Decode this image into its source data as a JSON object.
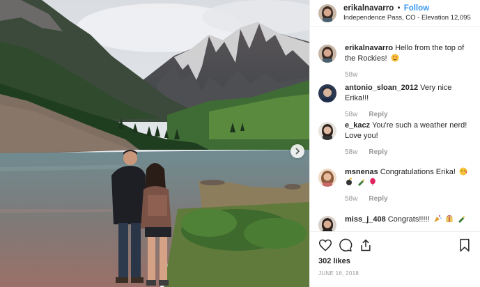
{
  "post": {
    "username": "erikalnavarro",
    "separator": "•",
    "follow_label": "Follow",
    "location": "Independence Pass, CO - Elevation 12,095",
    "likes": "302 likes",
    "date": "JUNE 16, 2018"
  },
  "comments": [
    {
      "username": "erikalnavarro",
      "text": "Hello from the top of the Rockies!",
      "emoji": [
        "heart-eyes"
      ],
      "time": "58w",
      "reply": ""
    },
    {
      "username": "antonio_sloan_2012",
      "text": "Very nice Erika!!!",
      "emoji": [],
      "time": "58w",
      "reply": "Reply"
    },
    {
      "username": "e_kacz",
      "text": "You're such a weather nerd! Love you!",
      "emoji": [],
      "time": "58w",
      "reply": "Reply"
    },
    {
      "username": "msnenas",
      "text": "Congratulations Erika!",
      "emoji": [
        "kiss-heart",
        "sparkle-bomb",
        "champagne",
        "balloon"
      ],
      "time": "58w",
      "reply": "Reply"
    },
    {
      "username": "miss_j_408",
      "text": "Congrats!!!!!",
      "emoji": [
        "party-popper",
        "tada-box",
        "champagne"
      ],
      "time": "",
      "reply": ""
    }
  ],
  "icons": {
    "like": "heart-outline-icon",
    "comment": "comment-bubble-icon",
    "share": "share-icon",
    "save": "bookmark-icon",
    "carousel": "chevron-right-icon"
  },
  "colors": {
    "follow": "#3897f0",
    "meta": "#999999",
    "text": "#262626"
  }
}
